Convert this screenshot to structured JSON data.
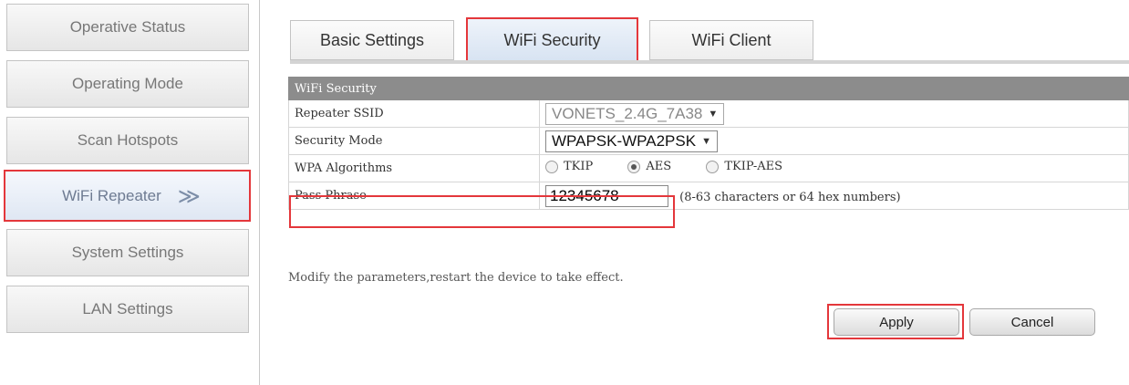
{
  "sidebar": {
    "items": [
      {
        "label": "Operative Status"
      },
      {
        "label": "Operating Mode"
      },
      {
        "label": "Scan Hotspots"
      },
      {
        "label": "WiFi Repeater",
        "arrow": "≫"
      },
      {
        "label": "System Settings"
      },
      {
        "label": "LAN Settings"
      }
    ],
    "active_index": 3
  },
  "tabs": [
    {
      "label": "Basic Settings"
    },
    {
      "label": "WiFi Security"
    },
    {
      "label": "WiFi Client"
    }
  ],
  "active_tab": 1,
  "section": {
    "header": "WiFi Security",
    "rows": {
      "ssid": {
        "label": "Repeater SSID",
        "value": "VONETS_2.4G_7A38"
      },
      "security_mode": {
        "label": "Security Mode",
        "value": "WPAPSK-WPA2PSK"
      },
      "algorithms": {
        "label": "WPA Algorithms",
        "options": [
          "TKIP",
          "AES",
          "TKIP-AES"
        ],
        "selected": "AES"
      },
      "pass_phrase": {
        "label": "Pass Phrase",
        "value": "12345678",
        "hint": "(8-63 characters or 64 hex numbers)"
      }
    }
  },
  "note": "Modify the parameters,restart the device to take effect.",
  "buttons": {
    "apply": "Apply",
    "cancel": "Cancel"
  },
  "colors": {
    "highlight": "#e4373b",
    "header_bg": "#8c8c8c",
    "active_tab_bg": "#d7e3f2"
  },
  "icons": {
    "caret": "▼",
    "repeater_arrow": "double-chevron-right-icon"
  }
}
